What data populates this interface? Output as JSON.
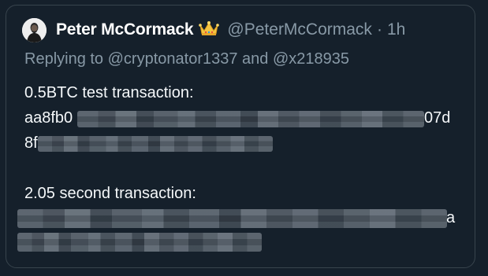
{
  "tweet": {
    "display_name": "Peter McCormack",
    "handle": "@PeterMcCormack",
    "separator": "·",
    "time": "1h",
    "reply_prefix": "Replying to",
    "reply_mention_1": "@cryptonator1337",
    "reply_and": "and",
    "reply_mention_2": "@x218935",
    "line1": "0.5BTC test transaction:",
    "line2_start": "aa8fb0",
    "line2_end": "07d",
    "line3_start": "8f",
    "line4": "2.05 second transaction:",
    "line5_end": "a"
  },
  "colors": {
    "background": "#15202b",
    "border": "#38444d",
    "text": "#f5f8fa",
    "secondary": "#8899a6",
    "crown": "#f4c542"
  },
  "icons": {
    "crown": "crown-emoji",
    "avatar": "profile-photo"
  }
}
